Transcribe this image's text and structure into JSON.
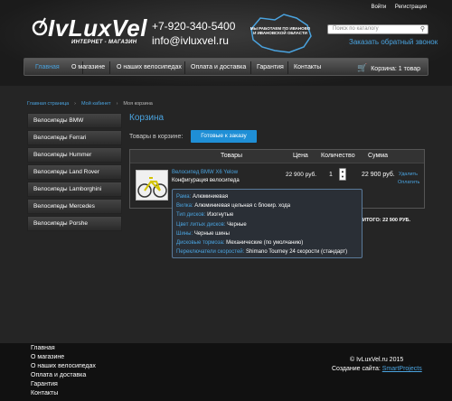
{
  "header": {
    "logo_text": "IvLuxVel",
    "logo_tagline": "ИНТЕРНЕТ - МАГАЗИН",
    "phone": "+7-920-340-5400",
    "email": "info@ivluxvel.ru",
    "map_text": "МЫ РАБОТАЕМ ПО ИВАНОВО И ИВАНОВСКОЙ ОБЛАСТИ",
    "login": "Войти",
    "register": "Регистрация",
    "search_placeholder": "Поиск по каталогу",
    "callback": "Заказать обратный звонок"
  },
  "nav": {
    "items": [
      "Главная",
      "О магазине",
      "О наших велосипедах",
      "Оплата и доставка",
      "Гарантия",
      "Контакты"
    ],
    "cart_label": "Корзина: 1 товар"
  },
  "breadcrumbs": {
    "home": "Главная страница",
    "cabinet": "Мой кабинет",
    "current": "Моя корзина",
    "separator": "›"
  },
  "sidebar": {
    "items": [
      "Велосипеды BMW",
      "Велосипеды Ferrari",
      "Велосипеды Hummer",
      "Велосипеды Land Rover",
      "Велосипеды Lamborghini",
      "Велосипеды Mercedes",
      "Велосипеды Porshe"
    ]
  },
  "cart": {
    "title": "Корзина",
    "items_label": "Товары в корзине:",
    "order_button": "Готовые к заказу",
    "headers": {
      "goods": "Товары",
      "price": "Цена",
      "qty": "Количество",
      "sum": "Сумма"
    },
    "item": {
      "name": "Велосипед BMW X6 Yelow",
      "config": "Конфигурация велосипеда",
      "price": "22 900 руб.",
      "qty": "1",
      "sum": "22 900 руб.",
      "delete": "Удалить",
      "edit": "Оплатить"
    },
    "total": "ИТОГО: 22 900 РУБ."
  },
  "config_popup": {
    "rows": [
      {
        "k": "Рама:",
        "v": "Алюминиевая"
      },
      {
        "k": "Вилка:",
        "v": "Алюминиевая цельная с блокир. хода"
      },
      {
        "k": "Тип дисков:",
        "v": "Изогнутые"
      },
      {
        "k": "Цвет литых дисков:",
        "v": "Черные"
      },
      {
        "k": "Шины:",
        "v": "Черные шины"
      },
      {
        "k": "Дисковые тормоза:",
        "v": "Механические (по умолчанию)"
      },
      {
        "k": "Переключатели скоростей:",
        "v": "Shimano Tourney 24 скорости (стандарт)"
      }
    ]
  },
  "footer": {
    "links": [
      "Главная",
      "О магазине",
      "О наших велосипедах",
      "Оплата и доставка",
      "Гарантия",
      "Контакты"
    ],
    "copyright": "© IvLuxVel.ru 2015",
    "made_by_label": "Создание сайта:",
    "made_by_link": "SmartProjects"
  }
}
